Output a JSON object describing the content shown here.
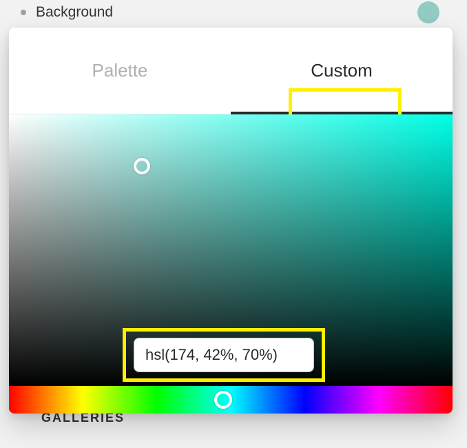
{
  "header": {
    "label": "Background",
    "swatch_color": "#91cbc3"
  },
  "picker": {
    "tabs": {
      "palette": "Palette",
      "custom": "Custom",
      "active": "custom"
    },
    "hue_deg": 174,
    "color_value": "hsl(174, 42%, 70%)"
  },
  "section_below": {
    "label": "GALLERIES"
  }
}
